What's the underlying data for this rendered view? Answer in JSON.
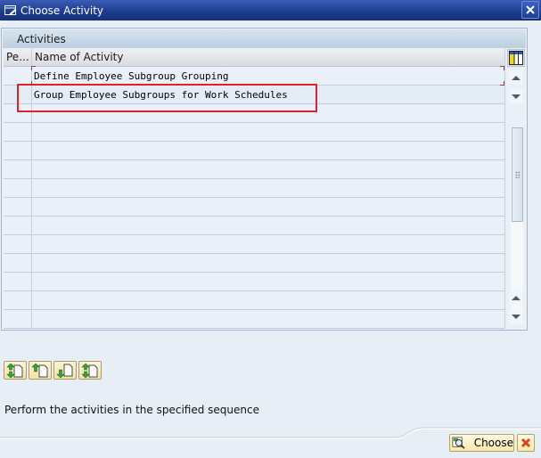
{
  "window": {
    "title": "Choose Activity",
    "title_icon": "dialog-icon",
    "close_icon": "close-icon"
  },
  "activities_panel": {
    "header": "Activities",
    "columns": [
      "Pe...",
      "Name of Activity"
    ],
    "rows": [
      {
        "performed": "",
        "name": "Define Employee Subgroup Grouping"
      },
      {
        "performed": "",
        "name": "Group Employee Subgroups for Work Schedules"
      },
      {
        "performed": "",
        "name": ""
      },
      {
        "performed": "",
        "name": ""
      },
      {
        "performed": "",
        "name": ""
      },
      {
        "performed": "",
        "name": ""
      },
      {
        "performed": "",
        "name": ""
      },
      {
        "performed": "",
        "name": ""
      },
      {
        "performed": "",
        "name": ""
      },
      {
        "performed": "",
        "name": ""
      },
      {
        "performed": "",
        "name": ""
      },
      {
        "performed": "",
        "name": ""
      },
      {
        "performed": "",
        "name": ""
      },
      {
        "performed": "",
        "name": ""
      }
    ],
    "column_setup_icon": "column-setup-icon"
  },
  "navigation_buttons": [
    {
      "name": "first-page-button",
      "icon": "first-page-icon"
    },
    {
      "name": "previous-page-button",
      "icon": "previous-page-icon"
    },
    {
      "name": "next-page-button",
      "icon": "next-page-icon"
    },
    {
      "name": "last-page-button",
      "icon": "last-page-icon"
    }
  ],
  "status_text": "Perform the activities in the specified sequence",
  "footer": {
    "choose_label": "Choose",
    "choose_icon": "choose-icon",
    "cancel_icon": "cancel-icon"
  },
  "colors": {
    "title_bar": "#1c3b8f",
    "highlight": "#e2222a",
    "background": "#e7eef6"
  }
}
